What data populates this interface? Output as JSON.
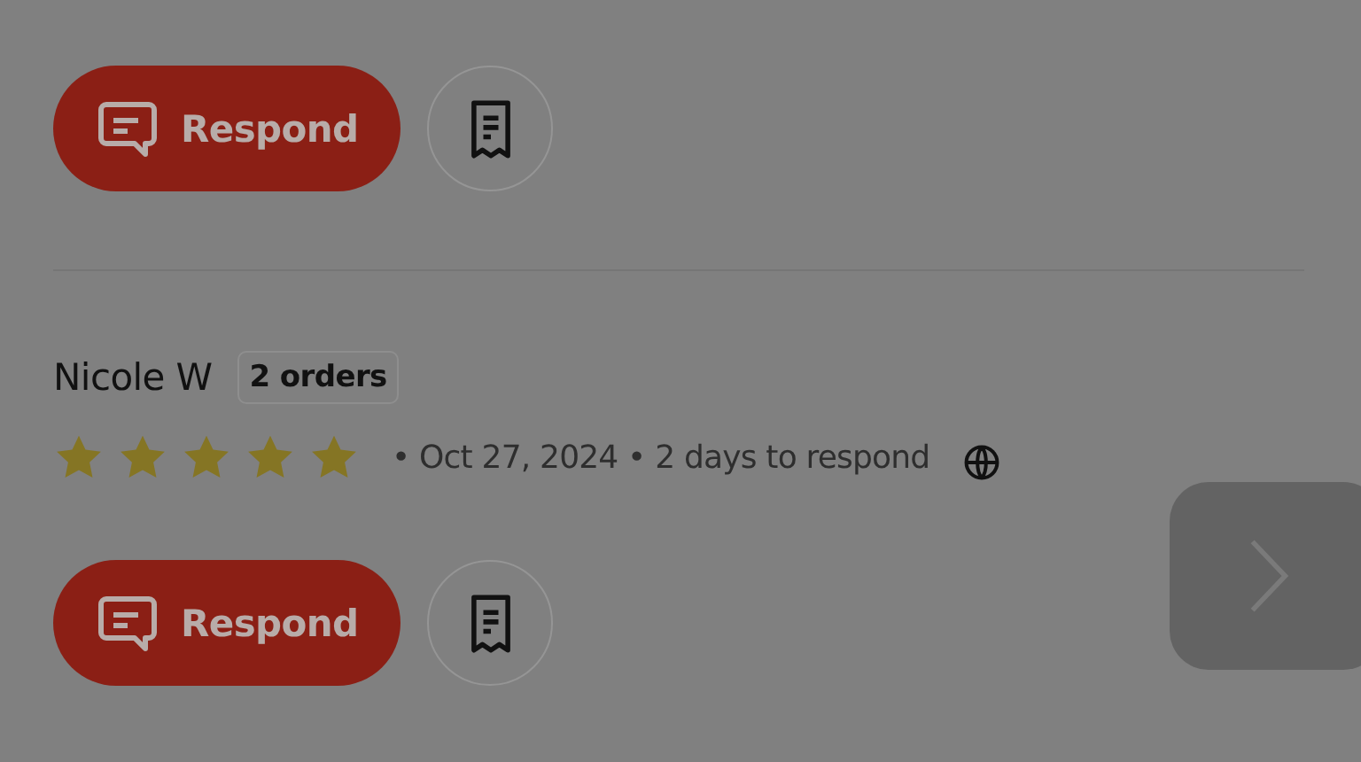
{
  "reviews": [
    {
      "respond_label": "Respond"
    },
    {
      "name": "Nicole W",
      "orders": "2 orders",
      "stars": 5,
      "meta": "• Oct 27, 2024 • 2 days to respond",
      "respond_label": "Respond"
    }
  ]
}
